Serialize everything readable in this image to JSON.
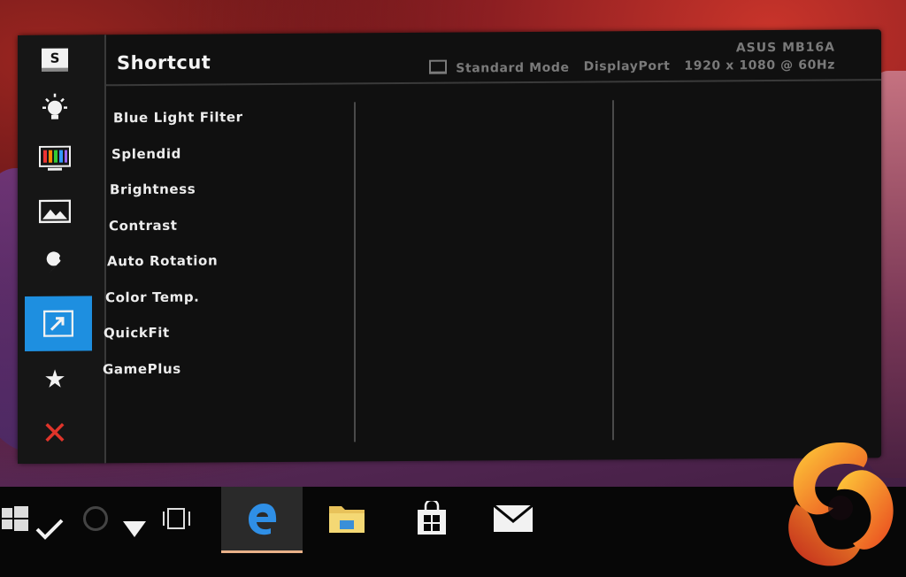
{
  "osd": {
    "title": "Shortcut",
    "model": "ASUS MB16A",
    "mode": "Standard Mode",
    "input": "DisplayPort",
    "resolution": "1920 x 1080 @ 60Hz",
    "sidebar_icons": [
      "s-icon",
      "bulb-icon",
      "color-bars-icon",
      "image-icon",
      "wrench-icon",
      "shortcut-arrow-icon",
      "star-icon",
      "close-icon"
    ],
    "active_icon": "shortcut-arrow-icon",
    "menu_items": [
      {
        "label": "Blue Light Filter"
      },
      {
        "label": "Splendid"
      },
      {
        "label": "Brightness"
      },
      {
        "label": "Contrast"
      },
      {
        "label": "Auto Rotation"
      },
      {
        "label": "Color Temp."
      },
      {
        "label": "QuickFit"
      },
      {
        "label": "GamePlus"
      }
    ],
    "accent_color": "#1e8fe0",
    "close_color": "#e0342a"
  },
  "taskbar": {
    "items": [
      "windows-start-icon",
      "check-icon",
      "cortana-circle-icon",
      "down-arrow-icon",
      "task-view-icon",
      "edge-icon",
      "file-explorer-icon",
      "store-icon",
      "mail-icon"
    ],
    "active_item": "edge-icon"
  },
  "sidebar": {
    "s_letter": "S"
  }
}
